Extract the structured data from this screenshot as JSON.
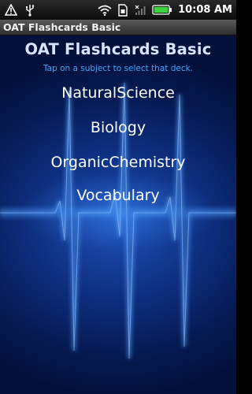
{
  "status_bar": {
    "time": "10:08 AM",
    "icons": [
      "warning-icon",
      "usb-icon",
      "wifi-icon",
      "sim-card-icon",
      "signal-icon",
      "battery-icon"
    ]
  },
  "title_bar": {
    "title": "OAT Flashcards Basic"
  },
  "main": {
    "heading": "OAT Flashcards Basic",
    "subtitle": "Tap on a subject to select that deck.",
    "decks": [
      {
        "label": "NaturalScience"
      },
      {
        "label": "Biology"
      },
      {
        "label": "OrganicChemistry"
      },
      {
        "label": "Vocabulary"
      }
    ]
  },
  "colors": {
    "subtitle": "#3fa7ff",
    "heading": "#d6e4ff",
    "background": "#0d2d7c",
    "wave": "#6fb6ff"
  }
}
